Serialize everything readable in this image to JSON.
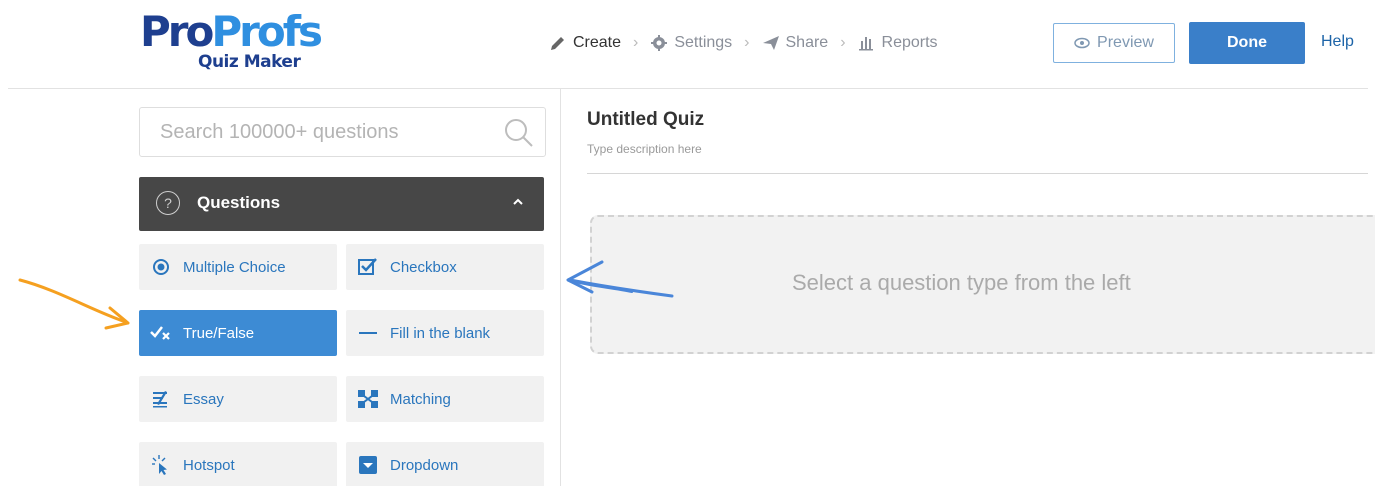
{
  "logo": {
    "brand_part1": "Pro",
    "brand_part2": "Profs",
    "product": "Quiz Maker"
  },
  "steps": [
    {
      "label": "Create",
      "icon": "pencil-icon",
      "active": true
    },
    {
      "label": "Settings",
      "icon": "gear-icon",
      "active": false
    },
    {
      "label": "Share",
      "icon": "paper-plane-icon",
      "active": false
    },
    {
      "label": "Reports",
      "icon": "bar-chart-icon",
      "active": false
    }
  ],
  "header": {
    "preview_label": "Preview",
    "done_label": "Done",
    "help_label": "Help"
  },
  "search": {
    "placeholder": "Search 100000+ questions"
  },
  "questions_panel": {
    "title": "Questions",
    "types": [
      {
        "label": "Multiple Choice",
        "icon": "radio-icon",
        "selected": false
      },
      {
        "label": "Checkbox",
        "icon": "checkbox-icon",
        "selected": false
      },
      {
        "label": "True/False",
        "icon": "true-false-icon",
        "selected": true
      },
      {
        "label": "Fill in the blank",
        "icon": "dash-icon",
        "selected": false
      },
      {
        "label": "Essay",
        "icon": "essay-icon",
        "selected": false
      },
      {
        "label": "Matching",
        "icon": "matching-icon",
        "selected": false
      },
      {
        "label": "Hotspot",
        "icon": "hotspot-icon",
        "selected": false
      },
      {
        "label": "Dropdown",
        "icon": "dropdown-icon",
        "selected": false
      }
    ]
  },
  "quiz": {
    "title": "Untitled Quiz",
    "description_placeholder": "Type description here"
  },
  "dropzone": {
    "text": "Select a question type from the left"
  },
  "colors": {
    "brand_dark": "#1e3f8f",
    "brand_light": "#2f8fe0",
    "accent": "#3a7fc9",
    "selected": "#3d8bd4",
    "annotation_orange": "#f5a020",
    "annotation_blue": "#4a86d9"
  }
}
